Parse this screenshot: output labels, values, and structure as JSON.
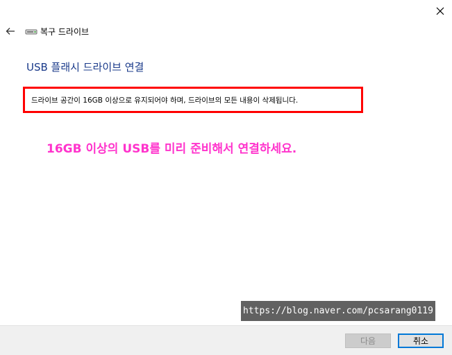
{
  "window": {
    "title": "복구 드라이브",
    "close_icon": "close-icon",
    "back_icon": "back-arrow-icon",
    "drive_icon": "drive-icon"
  },
  "main": {
    "heading": "USB 플래시 드라이브 연결",
    "warning": "드라이브 공간이 16GB 이상으로 유지되어야 하며, 드라이브의 모든 내용이 삭제됩니다.",
    "annotation": "16GB 이상의 USB를 미리 준비해서 연결하세요.",
    "watermark": "https://blog.naver.com/pcsarang0119"
  },
  "footer": {
    "next_label": "다음",
    "cancel_label": "취소"
  },
  "colors": {
    "heading": "#1a3a8a",
    "highlight_border": "#ff0000",
    "annotation": "#ff33cc",
    "accent": "#0078d7"
  }
}
